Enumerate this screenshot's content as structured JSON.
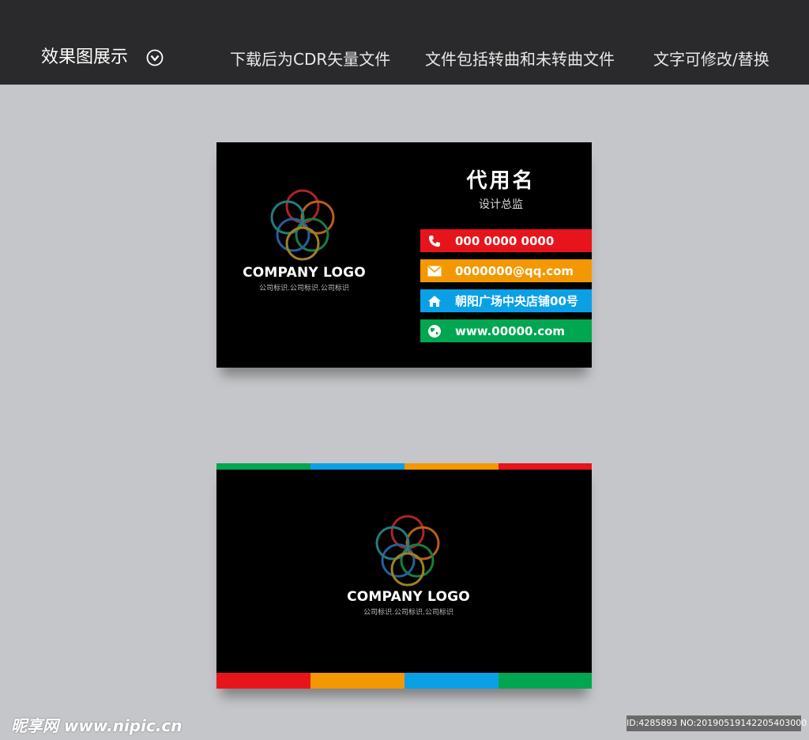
{
  "header": {
    "title": "效果图展示",
    "notes": [
      "下载后为CDR矢量文件",
      "文件包括转曲和未转曲文件",
      "文字可修改/替换"
    ],
    "bg_color": "#2a2a2c",
    "chevron_icon": "circle-chevron-down-icon"
  },
  "front_card": {
    "name": "代用名",
    "role": "设计总监",
    "logo_title": "COMPANY LOGO",
    "logo_subtitle": "公司标识.公司标识.公司标识",
    "contacts": [
      {
        "icon": "phone-icon",
        "text": "000 0000 0000",
        "color": "#e8141c"
      },
      {
        "icon": "envelope-icon",
        "text": "0000000@qq.com",
        "color": "#f39800"
      },
      {
        "icon": "home-icon",
        "text": "朝阳广场中央店铺00号",
        "color": "#0aa0e6"
      },
      {
        "icon": "globe-icon",
        "text": "www.00000.com",
        "color": "#00a650"
      }
    ]
  },
  "back_card": {
    "logo_title": "COMPANY LOGO",
    "logo_subtitle": "公司标识.公司标识.公司标识",
    "top_stripe_colors": [
      "#00a650",
      "#0aa0e6",
      "#f39800",
      "#e8141c"
    ],
    "bottom_stripe_colors": [
      "#e8141c",
      "#f39800",
      "#0aa0e6",
      "#00a650"
    ]
  },
  "footer": {
    "watermark": "昵享网 www.nipic.cn",
    "image_id": "ID:4285893 NO:20190519142205403000"
  }
}
